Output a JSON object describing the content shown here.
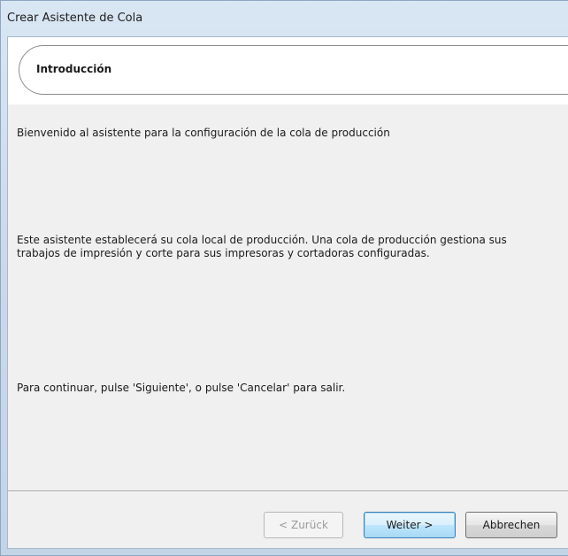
{
  "window": {
    "title": "Crear Asistente de Cola"
  },
  "header": {
    "title": "Introducción"
  },
  "content": {
    "welcome": "Bienvenido al asistente para la configuración de la cola de producción",
    "description": "Este asistente establecerá su cola local de producción. Una cola de producción gestiona sus trabajos de impresión y corte para sus impresoras y cortadoras configuradas.",
    "continue": "Para continuar, pulse 'Siguiente', o pulse 'Cancelar' para salir."
  },
  "buttons": {
    "back": {
      "label": "< Zurück",
      "enabled": false
    },
    "next": {
      "label": "Weiter >",
      "enabled": true,
      "default": true
    },
    "cancel": {
      "label": "Abbrechen",
      "enabled": true
    }
  }
}
